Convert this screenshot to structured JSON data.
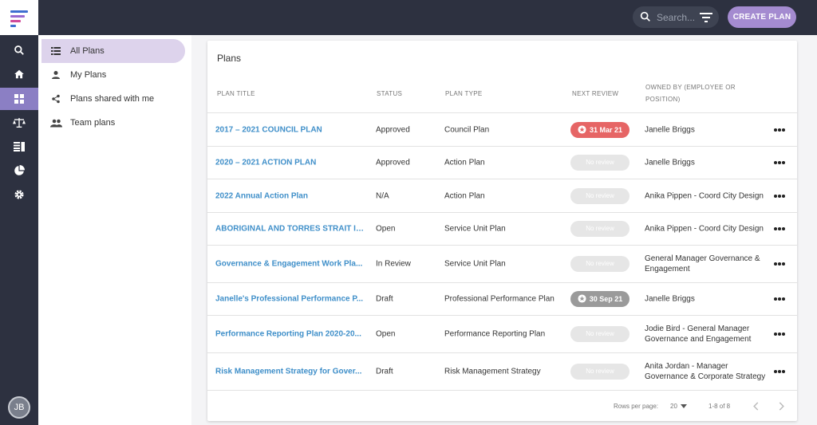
{
  "header": {
    "search_placeholder": "Search...",
    "create_button": "CREATE PLAN"
  },
  "user": {
    "initials": "JB"
  },
  "subnav": {
    "items": [
      {
        "label": "All Plans",
        "icon": "list-icon"
      },
      {
        "label": "My Plans",
        "icon": "person-icon"
      },
      {
        "label": "Plans shared with me",
        "icon": "share-icon"
      },
      {
        "label": "Team plans",
        "icon": "group-icon"
      }
    ]
  },
  "table": {
    "title": "Plans",
    "columns": [
      "PLAN TITLE",
      "STATUS",
      "PLAN TYPE",
      "NEXT REVIEW",
      "OWNED BY (EMPLOYEE OR",
      "POSITION)"
    ],
    "rows": [
      {
        "title": "2017 – 2021 COUNCIL PLAN",
        "status": "Approved",
        "type": "Council Plan",
        "review": "31 Mar 21",
        "owner1": "Janelle Briggs",
        "owner2": ""
      },
      {
        "title": "2020 – 2021 ACTION PLAN",
        "status": "Approved",
        "type": "Action Plan",
        "review": "No review",
        "owner1": "Janelle Briggs",
        "owner2": ""
      },
      {
        "title": "2022 Annual Action Plan",
        "status": "N/A",
        "type": "Action Plan",
        "review": "No review",
        "owner1": "Anika Pippen - Coord City Design",
        "owner2": ""
      },
      {
        "title": "ABORIGINAL AND TORRES STRAIT IS...",
        "status": "Open",
        "type": "Service Unit Plan",
        "review": "No review",
        "owner1": "Anika Pippen - Coord City Design",
        "owner2": ""
      },
      {
        "title": "Governance & Engagement Work Pla...",
        "status": "In Review",
        "type": "Service Unit Plan",
        "review": "No review",
        "owner1": "General Manager Governance &",
        "owner2": "Engagement"
      },
      {
        "title": "Janelle's Professional Performance P...",
        "status": "Draft",
        "type": "Professional Performance Plan",
        "review": "30 Sep 21",
        "owner1": "Janelle Briggs",
        "owner2": ""
      },
      {
        "title": "Performance Reporting Plan 2020-20...",
        "status": "Open",
        "type": "Performance Reporting Plan",
        "review": "No review",
        "owner1": "Jodie Bird - General Manager",
        "owner2": "Governance and Engagement"
      },
      {
        "title": "Risk Management Strategy for Gover...",
        "status": "Draft",
        "type": "Risk Management Strategy",
        "review": "No review",
        "owner1": "Anita Jordan - Manager",
        "owner2": "Governance & Corporate Strategy"
      }
    ]
  },
  "footer": {
    "rows_per_page_label": "Rows per page:",
    "rows_per_page_value": "20",
    "range": "1-8 of 8"
  },
  "colors": {
    "topbar": "#2d3140",
    "accent": "#a48bd0",
    "link": "#3f8fc9",
    "overdue": "#e66565"
  }
}
